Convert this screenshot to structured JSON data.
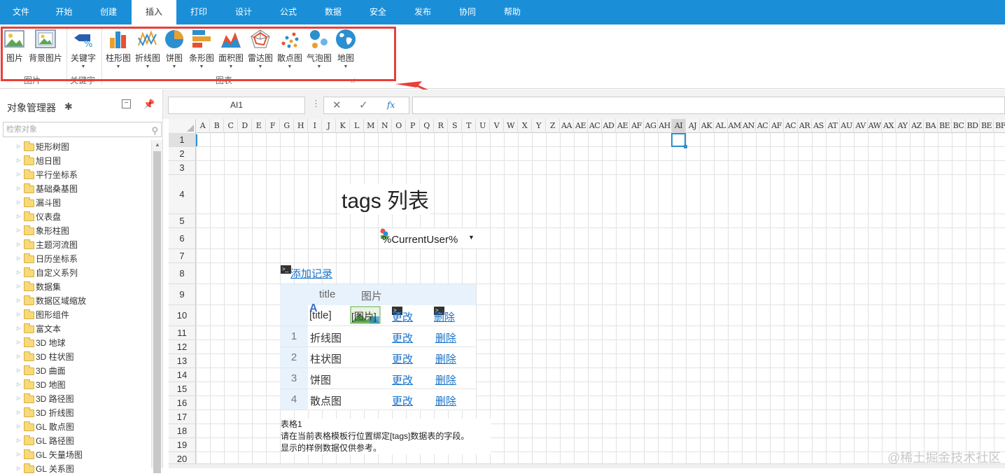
{
  "menu": {
    "items": [
      "文件",
      "开始",
      "创建",
      "插入",
      "打印",
      "设计",
      "公式",
      "数据",
      "安全",
      "发布",
      "协同",
      "帮助"
    ],
    "active": "插入"
  },
  "ribbon": {
    "groups": [
      {
        "label": "图片",
        "buttons": [
          "图片",
          "背景图片"
        ]
      },
      {
        "label": "关键字",
        "buttons": [
          "关键字"
        ]
      },
      {
        "label": "图表",
        "buttons": [
          "柱形图",
          "折线图",
          "饼图",
          "条形图",
          "面积图",
          "雷达图",
          "散点图",
          "气泡图",
          "地图"
        ]
      }
    ]
  },
  "panel": {
    "title": "对象管理器",
    "search_placeholder": "检索对象",
    "tree": [
      "矩形树图",
      "旭日图",
      "平行坐标系",
      "基础桑基图",
      "漏斗图",
      "仪表盘",
      "象形柱图",
      "主题河流图",
      "日历坐标系",
      "自定义系列",
      "数据集",
      "数据区域缩放",
      "图形组件",
      "富文本",
      "3D 地球",
      "3D 柱状图",
      "3D 曲面",
      "3D 地图",
      "3D 路径图",
      "3D 折线图",
      "GL 散点图",
      "GL 路径图",
      "GL 矢量场图",
      "GL 关系图"
    ]
  },
  "formula": {
    "namebox": "AI1",
    "fx": "fx"
  },
  "sheet": {
    "columns": [
      "A",
      "B",
      "C",
      "D",
      "E",
      "F",
      "G",
      "H",
      "I",
      "J",
      "K",
      "L",
      "M",
      "N",
      "O",
      "P",
      "Q",
      "R",
      "S",
      "T",
      "U",
      "V",
      "W",
      "X",
      "Y",
      "Z",
      "AA",
      "AE",
      "AC",
      "AD",
      "AE",
      "AF",
      "AG",
      "AH",
      "AI",
      "AJ",
      "AK",
      "AL",
      "AM",
      "AN",
      "AC",
      "AF",
      "AC",
      "AR",
      "AS",
      "AT",
      "AU",
      "AV",
      "AW",
      "AX",
      "AY",
      "AZ",
      "BA",
      "BE",
      "BC",
      "BD",
      "BE",
      "BF"
    ],
    "selected_column": "AI",
    "rows": [
      "1",
      "2",
      "3",
      "4",
      "5",
      "6",
      "7",
      "8",
      "9",
      "10",
      "11",
      "12",
      "13",
      "14",
      "15",
      "16",
      "17",
      "18",
      "19",
      "20"
    ],
    "title": "tags 列表",
    "user": "%CurrentUser%",
    "add_record": "添加记录",
    "table": {
      "headers": [
        "title",
        "图片"
      ],
      "template": {
        "title": "[title]",
        "image": "[图片]",
        "edit": "更改",
        "delete": "删除"
      },
      "rows": [
        {
          "idx": "1",
          "title": "折线图",
          "edit": "更改",
          "delete": "删除"
        },
        {
          "idx": "2",
          "title": "柱状图",
          "edit": "更改",
          "delete": "删除"
        },
        {
          "idx": "3",
          "title": "饼图",
          "edit": "更改",
          "delete": "删除"
        },
        {
          "idx": "4",
          "title": "散点图",
          "edit": "更改",
          "delete": "删除"
        }
      ]
    },
    "note": [
      "表格1",
      "请在当前表格模板行位置绑定[tags]数据表的字段。",
      "显示的样例数据仅供参考。"
    ]
  },
  "watermark": "@稀土掘金技术社区",
  "colors": {
    "accent": "#1a8fd8",
    "highlight_box": "#e8403a",
    "link": "#1a73c8"
  }
}
